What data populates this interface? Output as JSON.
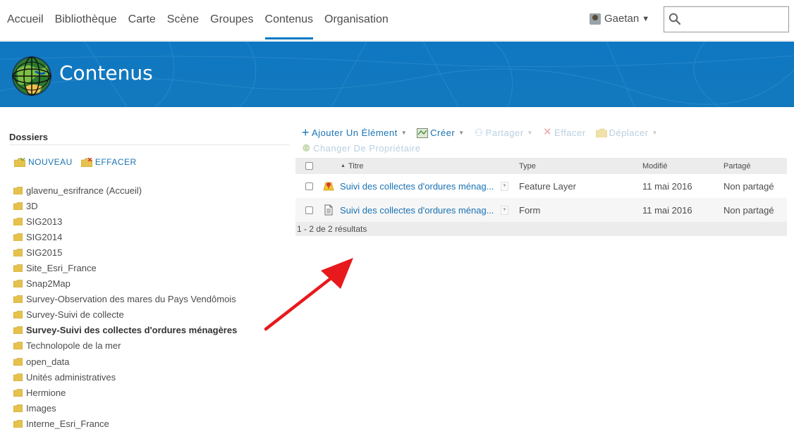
{
  "nav": {
    "items": [
      "Accueil",
      "Bibliothèque",
      "Carte",
      "Scène",
      "Groupes",
      "Contenus",
      "Organisation"
    ],
    "active_index": 5,
    "user_name": "Gaetan",
    "search_placeholder": ""
  },
  "banner": {
    "title": "Contenus"
  },
  "sidebar": {
    "title": "Dossiers",
    "new_label": "NOUVEAU",
    "delete_label": "EFFACER",
    "folders": [
      "glavenu_esrifrance (Accueil)",
      "3D",
      "SIG2013",
      "SIG2014",
      "SIG2015",
      "Site_Esri_France",
      "Snap2Map",
      "Survey-Observation des mares du Pays Vendômois",
      "Survey-Suivi de collecte",
      "Survey-Suivi des collectes d'ordures ménagères",
      "Technolopole de la mer",
      "open_data",
      "Unités administratives",
      "Hermione",
      "Images",
      "Interne_Esri_France"
    ],
    "active_folder_index": 9
  },
  "toolbar": {
    "add_item": "Ajouter Un Élément",
    "create": "Créer",
    "share": "Partager",
    "delete": "Effacer",
    "move": "Déplacer",
    "change_owner": "Changer De Propriétaire"
  },
  "table": {
    "headers": {
      "title": "Titre",
      "type": "Type",
      "modified": "Modifié",
      "shared": "Partagé"
    },
    "rows": [
      {
        "title": "Suivi des collectes d'ordures ménag...",
        "type": "Feature Layer",
        "modified": "11 mai 2016",
        "shared": "Non partagé",
        "icon": "feature-layer-icon"
      },
      {
        "title": "Suivi des collectes d'ordures ménag...",
        "type": "Form",
        "modified": "11 mai 2016",
        "shared": "Non partagé",
        "icon": "form-icon"
      }
    ],
    "footer": "1 - 2 de 2 résultats"
  },
  "colors": {
    "accent": "#0079c1",
    "link": "#1a73b3",
    "banner": "#1379be",
    "annotation_arrow": "#e8191c"
  }
}
